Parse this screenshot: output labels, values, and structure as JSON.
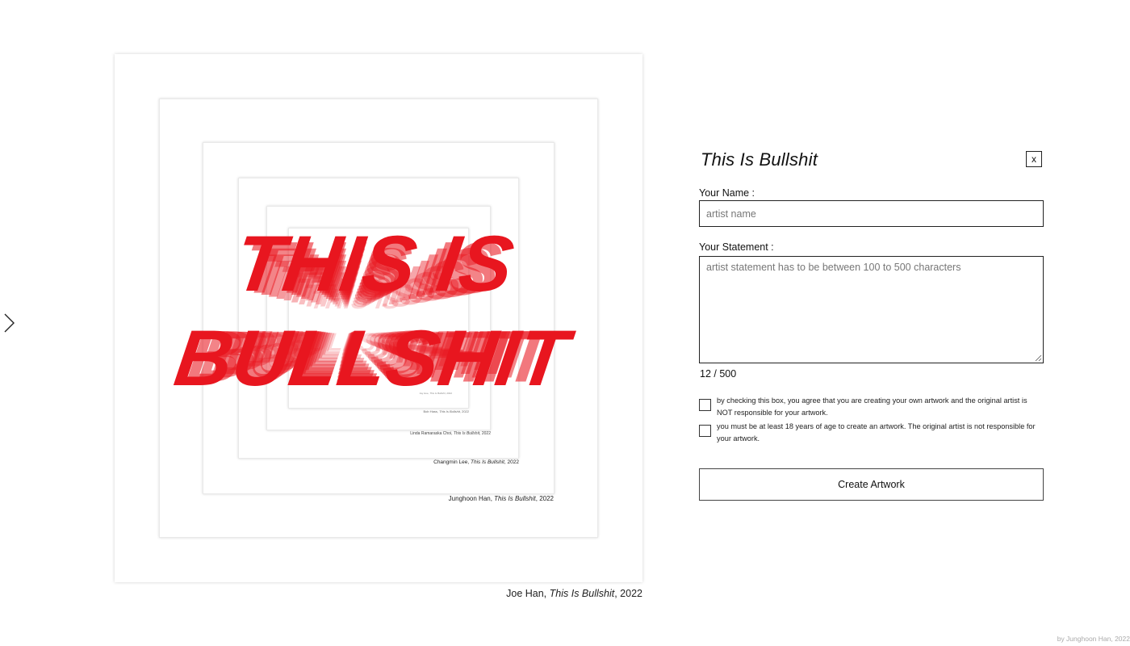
{
  "artwork": {
    "title_line1": "THIS IS",
    "title_line2": "BULLSHIT",
    "accent_color": "#e8161f",
    "frame_captions": [
      {
        "artist": "Junghoon Han, ",
        "title": "This Is Bullshit",
        "year": ", 2022"
      },
      {
        "artist": "Changmin Lee, ",
        "title": "This Is Bullshit",
        "year": ", 2022"
      },
      {
        "artist": "Linda Ramaraska Choi, ",
        "title": "This Is Bullshit",
        "year": ", 2022"
      },
      {
        "artist": "Bob Hass, ",
        "title": "This Is Bullshit",
        "year": ", 2022"
      },
      {
        "artist": "Jay Hoe, ",
        "title": "This Is Bullshit",
        "year": ", 2022"
      }
    ],
    "caption": {
      "artist": "Joe Han, ",
      "title": "This Is Bullshit",
      "year": ", 2022"
    }
  },
  "nav": {
    "next_icon": "chevron-right-icon"
  },
  "form": {
    "title": "This Is Bullshit",
    "close_label": "x",
    "name_label": "Your Name :",
    "name_placeholder": "artist name",
    "name_value": "",
    "statement_label": "Your Statement :",
    "statement_placeholder": "artist statement has to be between 100 to 500 characters",
    "statement_value": "",
    "counter": "12 / 500",
    "checkbox1_text": "by checking this box, you agree that you are creating your own artwork and the original artist is NOT responsible for your artwork.",
    "checkbox1_checked": false,
    "checkbox2_text": "you must be at least 18 years of age to create an artwork. The original artist is not responsible for your artwork.",
    "checkbox2_checked": false,
    "submit_label": "Create Artwork"
  },
  "footer": {
    "credit": "by Junghoon Han, 2022"
  }
}
